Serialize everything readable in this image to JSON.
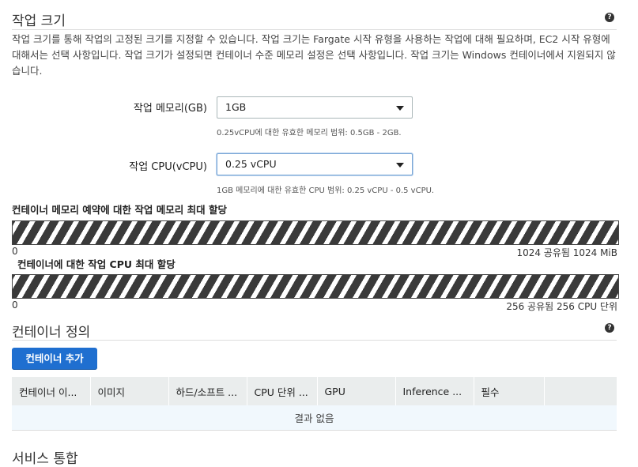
{
  "task_size": {
    "title": "작업 크기",
    "description": "작업 크기를 통해 작업의 고정된 크기를 지정할 수 있습니다. 작업 크기는 Fargate 시작 유형을 사용하는 작업에 대해 필요하며, EC2 시작 유형에 대해서는 선택 사항입니다. 작업 크기가 설정되면 컨테이너 수준 메모리 설정은 선택 사항입니다. 작업 크기는 Windows 컨테이너에서 지원되지 않습니다.",
    "memory_label": "작업 메모리(GB)",
    "memory_value": "1GB",
    "memory_hint": "0.25vCPU에 대한 유효한 메모리 범위: 0.5GB - 2GB.",
    "cpu_label": "작업 CPU(vCPU)",
    "cpu_value": "0.25 vCPU",
    "cpu_hint": "1GB 메모리에 대한 유효한 CPU 범위: 0.25 vCPU - 0.5 vCPU."
  },
  "memory_alloc": {
    "title": "컨테이너 메모리 예약에 대한 작업 메모리 최대 할당",
    "min": "0",
    "max_label": "1024 공유됨 1024 MiB",
    "shared_fraction": 1.0
  },
  "cpu_alloc": {
    "title": "컨테이너에 대한 작업 CPU 최대 할당",
    "min": "0",
    "max_label": "256 공유됨 256 CPU 단위",
    "shared_fraction": 1.0
  },
  "containers": {
    "title": "컨테이너 정의",
    "add_button": "컨테이너 추가",
    "columns": [
      "컨테이너 이...",
      "이미지",
      "하드/소프트 ...",
      "CPU 단위 ...",
      "GPU",
      "Inference ...",
      "필수",
      ""
    ],
    "empty_text": "결과 없음"
  },
  "next_section": {
    "title": "서비스 통합"
  },
  "icons": {
    "help": "help-icon",
    "dropdown": "chevron-down-icon"
  }
}
